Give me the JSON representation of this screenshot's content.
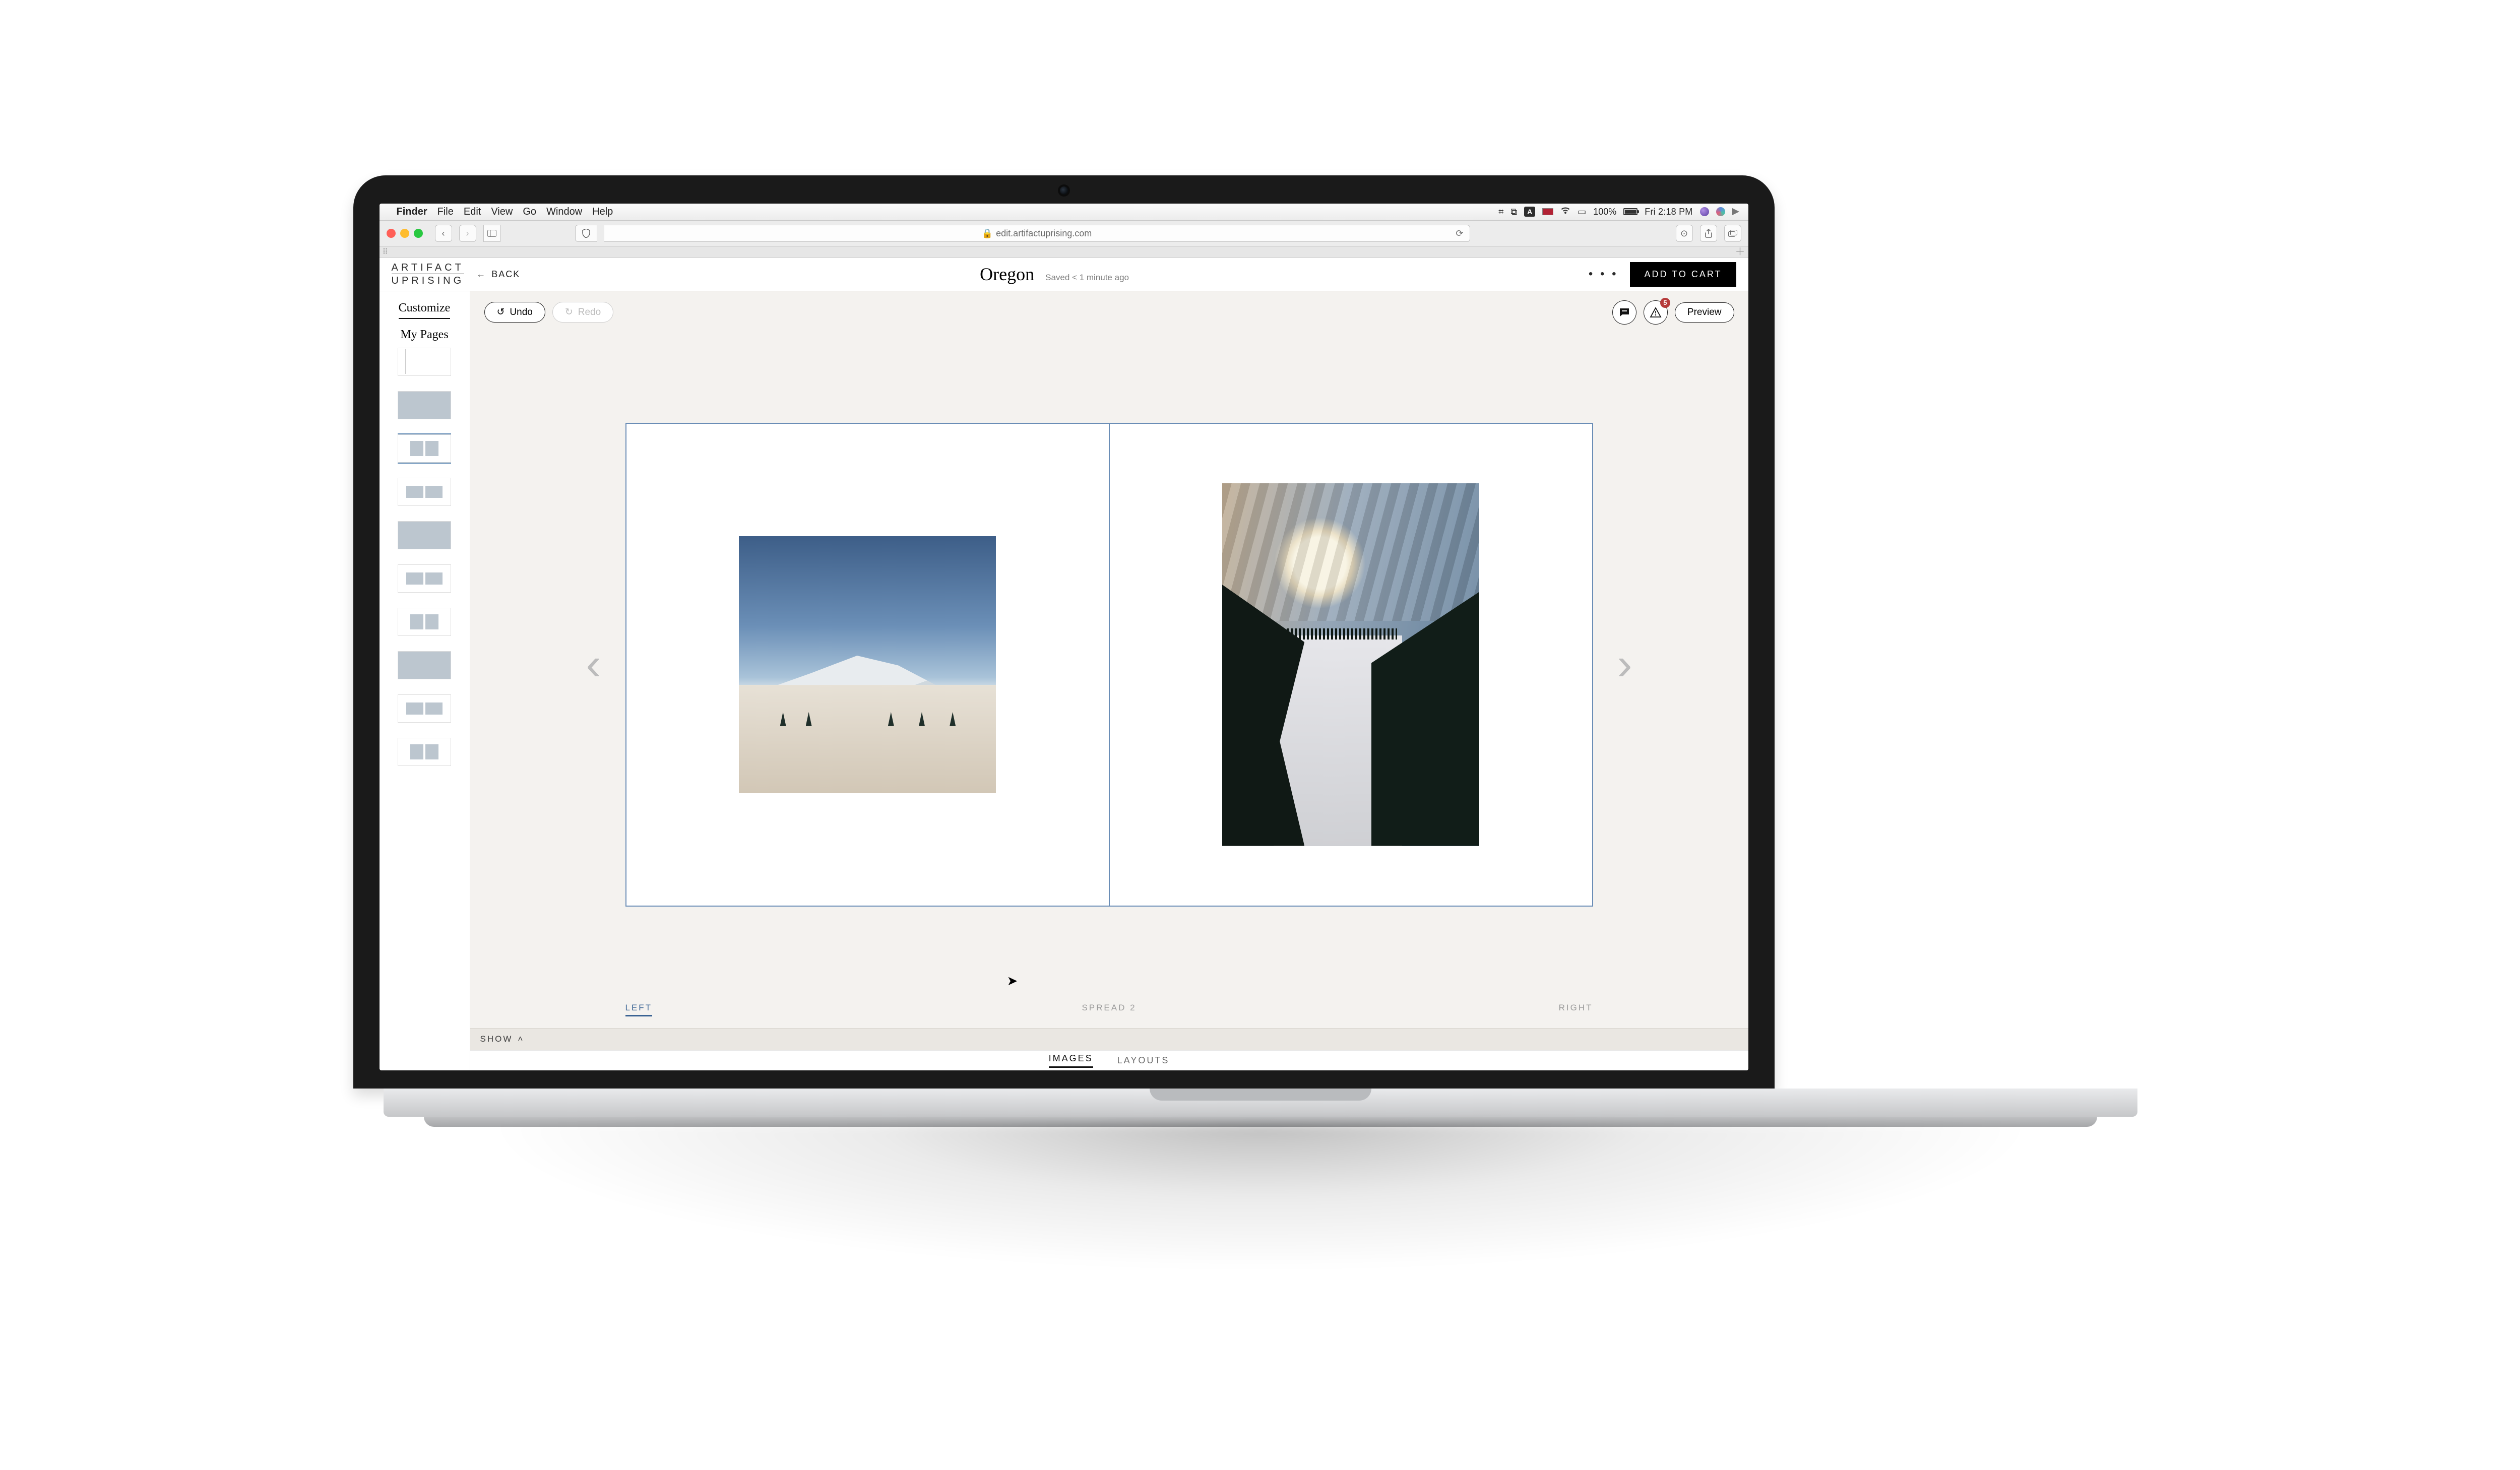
{
  "mac": {
    "app_name": "Finder",
    "menus": [
      "File",
      "Edit",
      "View",
      "Go",
      "Window",
      "Help"
    ],
    "battery_pct": "100%",
    "clock": "Fri 2:18 PM"
  },
  "browser": {
    "url_display": "edit.artifactuprising.com"
  },
  "brand": {
    "line1": "ARTIFACT",
    "line2": "UPRISING"
  },
  "header": {
    "back_label": "BACK",
    "project_title": "Oregon",
    "saved_text": "Saved < 1 minute ago",
    "add_to_cart": "ADD TO CART"
  },
  "sidebar": {
    "customize": "Customize",
    "my_pages": "My Pages"
  },
  "toolbar": {
    "undo": "Undo",
    "redo": "Redo",
    "preview": "Preview",
    "alert_count": "5"
  },
  "spread": {
    "left_label": "LEFT",
    "center_label": "SPREAD 2",
    "right_label": "RIGHT"
  },
  "footer": {
    "show": "SHOW",
    "tab_images": "IMAGES",
    "tab_layouts": "LAYOUTS"
  }
}
